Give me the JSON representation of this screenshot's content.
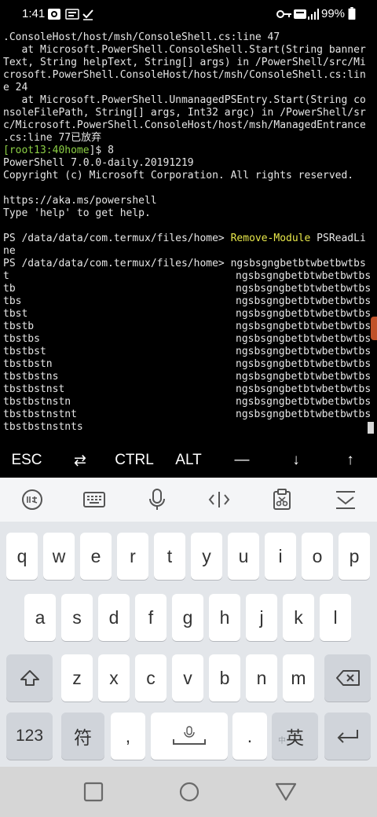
{
  "status_bar": {
    "time": "1:41",
    "battery": "99%"
  },
  "terminal": {
    "lines": [
      ".ConsoleHost/host/msh/ConsoleShell.cs:line 47",
      "   at Microsoft.PowerShell.ConsoleShell.Start(String banner",
      "Text, String helpText, String[] args) in /PowerShell/src/Mi",
      "crosoft.PowerShell.ConsoleHost/host/msh/ConsoleShell.cs:lin",
      "e 24",
      "   at Microsoft.PowerShell.UnmanagedPSEntry.Start(String co",
      "nsoleFilePath, String[] args, Int32 argc) in /PowerShell/sr",
      "c/Microsoft.PowerShell.ConsoleHost/host/msh/ManagedEntrance",
      ".cs:line 77已放弃"
    ],
    "prompt": {
      "open": "[",
      "user": "root13:40",
      "host": "home",
      "close": "]$ ",
      "command": "8"
    },
    "banner": [
      "PowerShell 7.0.0-daily.20191219",
      "Copyright (c) Microsoft Corporation. All rights reserved.",
      "",
      "https://aka.ms/powershell",
      "Type 'help' to get help."
    ],
    "ps_prompt": "PS /data/data/com.termux/files/home> ",
    "ps_command_1": "Remove-Module",
    "ps_command_1_rest": " PSReadLi",
    "ps_command_1_wrap": "ne",
    "ps_prompt_2": "PS /data/data/com.termux/files/home> ",
    "repeat_text": "ngsbsgngbetbtwbetbwtbs",
    "left_column": [
      "t",
      "tb",
      "tbs",
      "tbst",
      "tbstb",
      "tbstbs",
      "tbstbst",
      "tbstbstn",
      "tbstbstns",
      "tbstbstnst",
      "tbstbstnstn",
      "tbstbstnstnt",
      "tbstbstnstnts"
    ]
  },
  "extra_keys": {
    "esc": "ESC",
    "tab": "⇄",
    "ctrl": "CTRL",
    "alt": "ALT",
    "dash": "—",
    "down": "↓",
    "up": "↑"
  },
  "keyboard": {
    "row1": [
      "q",
      "w",
      "e",
      "r",
      "t",
      "y",
      "u",
      "i",
      "o",
      "p"
    ],
    "row2": [
      "a",
      "s",
      "d",
      "f",
      "g",
      "h",
      "j",
      "k",
      "l"
    ],
    "row3": [
      "z",
      "x",
      "c",
      "v",
      "b",
      "n",
      "m"
    ],
    "num_key": "123",
    "symbol_key": "符",
    "comma_key": ",",
    "period_key": ".",
    "lang_key": "英",
    "lang_key_sub": "中"
  },
  "colors": {
    "prompt_green": "#8ccf45",
    "command_yellow": "#e8e84a",
    "keyboard_bg": "#e3e6ea"
  }
}
